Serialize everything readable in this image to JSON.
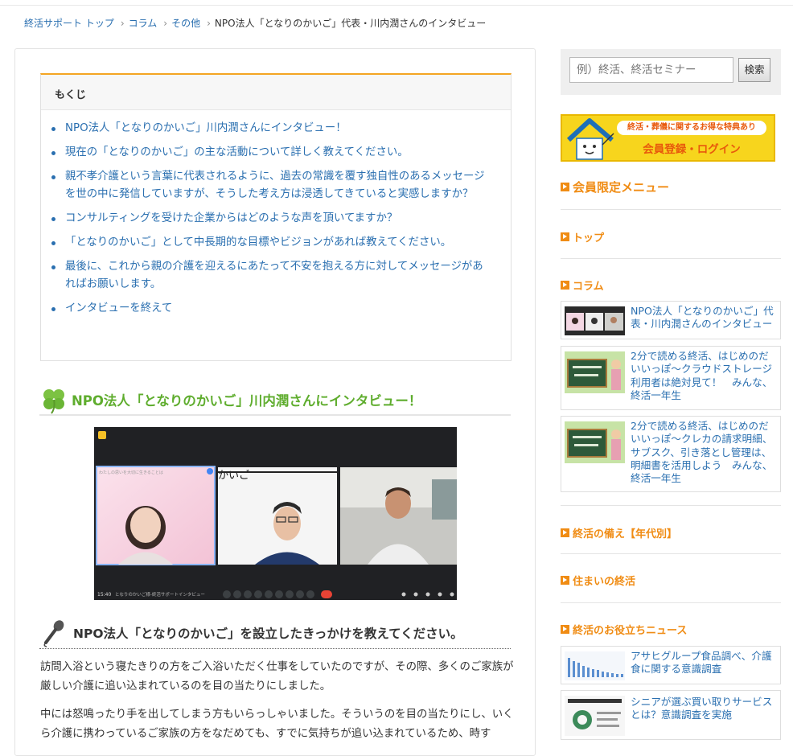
{
  "breadcrumb": {
    "items": [
      "終活サポート トップ",
      "コラム",
      "その他"
    ],
    "current": "NPO法人「となりのかいご」代表・川内潤さんのインタビュー"
  },
  "toc": {
    "heading": "もくじ",
    "items": [
      "NPO法人「となりのかいご」川内潤さんにインタビュー！",
      "現在の「となりのかいご」の主な活動について詳しく教えてください。",
      "親不孝介護という言葉に代表されるように、過去の常識を覆す独自性のあるメッセージを世の中に発信していますが、そうした考え方は浸透してきていると実感しますか？",
      "コンサルティングを受けた企業からはどのような声を頂いてますか？",
      "「となりのかいご」として中長期的な目標やビジョンがあれば教えてください。",
      "最後に、これから親の介護を迎えるにあたって不安を抱える方に対してメッセージがあればお願いします。",
      "インタビューを終えて"
    ]
  },
  "article": {
    "h2": "NPO法人「となりのかいご」川内潤さんにインタビュー！",
    "h3": "NPO法人「となりのかいご」を設立したきっかけを教えてください。",
    "paragraphs": [
      "訪問入浴という寝たきりの方をご入浴いただく仕事をしていたのですが、その際、多くのご家族が厳しい介護に追い込まれているのを目の当たりにしました。",
      "中には怒鳴ったり手を出してしまう方もいらっしゃいました。そういうのを目の当たりにし、いくら介護に携わっているご家族の方をなだめても、すでに気持ちが追い込まれているため、時す"
    ],
    "photo": {
      "tile1_caption": "わたしの思いを大切に生きることは",
      "tile2_text": "かいご",
      "time": "15:40",
      "meeting_title": "となりのかいご様-終活サポートインタビュー",
      "colors": {
        "bg": "#202124",
        "active_border": "#8ab4f8",
        "end_call": "#ea4335"
      }
    }
  },
  "sidebar": {
    "search": {
      "placeholder": "例）終活、終活セミナー",
      "button": "検索"
    },
    "banner": {
      "tagline": "終活・葬儀に関するお得な特典あり",
      "cta": "会員登録・ログイン"
    },
    "member_menu_title": "会員限定メニュー",
    "menu": {
      "top": "トップ",
      "column": "コラム",
      "sonae": "終活の備え【年代別】",
      "sumai": "住まいの終活",
      "news": "終活のお役立ちニュース"
    },
    "column_cards": [
      "NPO法人「となりのかいご」代表・川内潤さんのインタビュー",
      "2分で読める終活、はじめのだいいっぽ～クラウドストレージ利用者は絶対見て！　みんな、終活一年生",
      "2分で読める終活、はじめのだいいっぽ～クレカの請求明細、サブスク、引き落とし管理は、明細書を活用しよう　みんな、終活一年生"
    ],
    "news_cards": [
      "アサヒグループ食品調べ、介護食に関する意識調査",
      "シニアが選ぶ買い取りサービスとは？意識調査を実施"
    ],
    "colors": {
      "accent": "#f08c14",
      "link": "#2a6fb0",
      "banner": "#f7d51d"
    }
  }
}
